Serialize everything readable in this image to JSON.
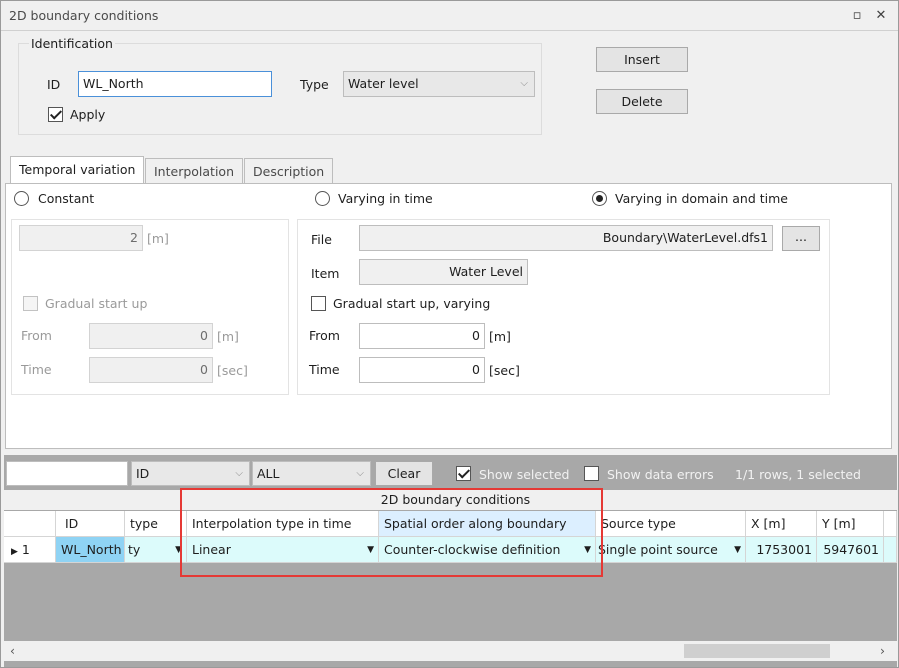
{
  "window": {
    "title": "2D boundary conditions"
  },
  "identification": {
    "group_label": "Identification",
    "id_label": "ID",
    "id_value": "WL_North",
    "type_label": "Type",
    "type_value": "Water level",
    "apply_label": "Apply",
    "apply_checked": true
  },
  "buttons": {
    "insert": "Insert",
    "delete": "Delete",
    "browse": "...",
    "clear": "Clear"
  },
  "tabs": [
    {
      "label": "Temporal variation",
      "active": true
    },
    {
      "label": "Interpolation",
      "active": false
    },
    {
      "label": "Description",
      "active": false
    }
  ],
  "temporal": {
    "constant_label": "Constant",
    "varying_time_label": "Varying in time",
    "varying_domain_time_label": "Varying in domain and time",
    "selected": "Varying in domain and time",
    "constant_value": "2",
    "constant_unit": "[m]",
    "gradual_label": "Gradual start up",
    "from_label": "From",
    "from_value": "0",
    "from_unit": "[m]",
    "time_label": "Time",
    "time_value": "0",
    "time_unit": "[sec]",
    "file_label": "File",
    "file_value": "Boundary\\WaterLevel.dfs1",
    "item_label": "Item",
    "item_value": "Water Level",
    "gradual_varying_label": "Gradual start up, varying",
    "from2_label": "From",
    "from2_value": "0",
    "from2_unit": "[m]",
    "time2_label": "Time",
    "time2_value": "0",
    "time2_unit": "[sec]"
  },
  "filter": {
    "search_value": "",
    "field_value": "ID",
    "scope_value": "ALL",
    "show_selected_label": "Show selected",
    "show_selected_checked": true,
    "show_errors_label": "Show data errors",
    "show_errors_checked": false,
    "status": "1/1 rows, 1 selected"
  },
  "grid": {
    "caption": "2D boundary conditions",
    "columns": [
      "ID",
      "type",
      "Interpolation type in time",
      "Spatial order along boundary",
      "Source type",
      "X [m]",
      "Y [m]"
    ],
    "rows": [
      {
        "num": "1",
        "id": "WL_North",
        "type": "ty",
        "interp": "Linear",
        "spatial": "Counter-clockwise definition",
        "source": "Single point source",
        "x": "1753001",
        "y": "5947601"
      }
    ]
  },
  "colors": {
    "highlight_box": "#e53935",
    "selection": "#dcfbfb",
    "id_cell": "#8fd3f4"
  }
}
